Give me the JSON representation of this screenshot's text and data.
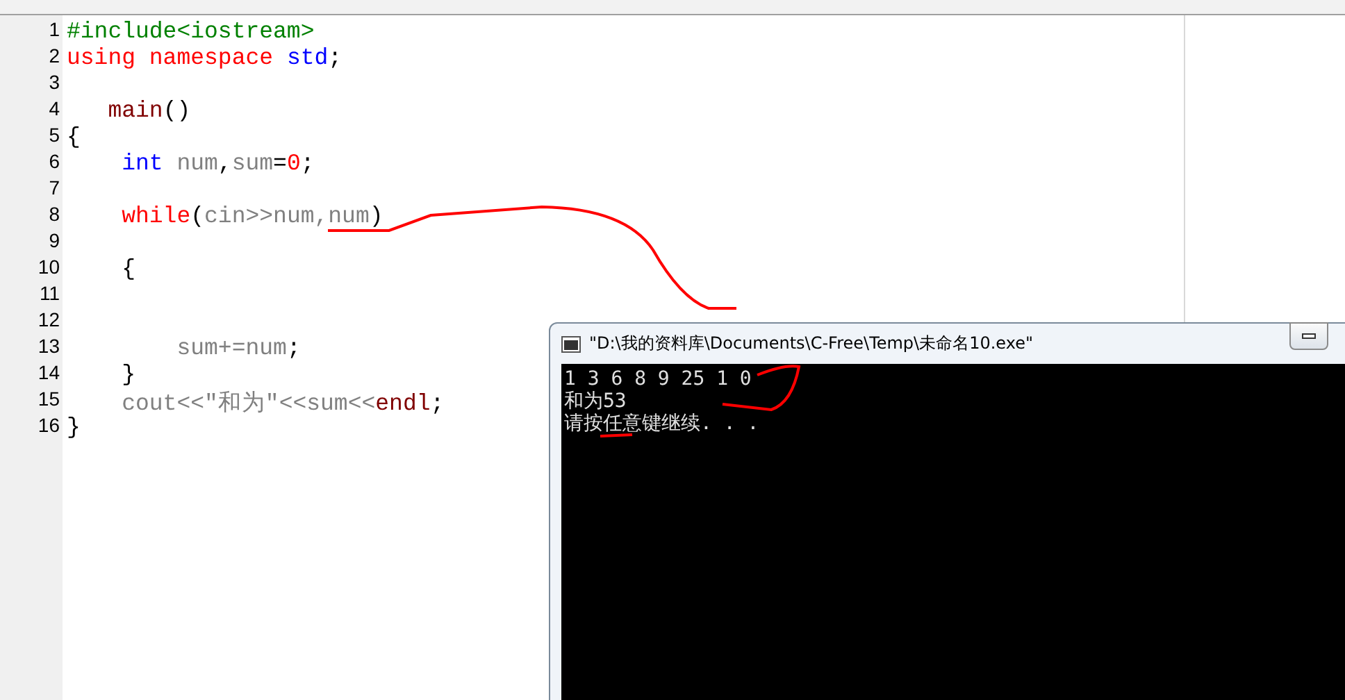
{
  "editor": {
    "lines": [
      {
        "number": "1",
        "tokens": [
          {
            "kind": "preprocessor",
            "text": "#include<iostream>"
          }
        ]
      },
      {
        "number": "2",
        "tokens": [
          {
            "kind": "keyword",
            "text": "using namespace "
          },
          {
            "kind": "type",
            "text": "std"
          },
          {
            "kind": "punct",
            "text": ";"
          }
        ]
      },
      {
        "number": "3"
      },
      {
        "number": "4",
        "tokens": [
          {
            "kind": "function",
            "text": "   main"
          },
          {
            "kind": "punct",
            "text": "()"
          }
        ]
      },
      {
        "number": "5",
        "tokens": [
          {
            "kind": "punct",
            "text": "{"
          }
        ]
      },
      {
        "number": "6",
        "tokens": [
          {
            "kind": "type",
            "text": "    int"
          },
          {
            "kind": "ident",
            "text": " num"
          },
          {
            "kind": "punct",
            "text": ","
          },
          {
            "kind": "ident",
            "text": "sum"
          },
          {
            "kind": "punct",
            "text": "="
          },
          {
            "kind": "number",
            "text": "0"
          },
          {
            "kind": "punct",
            "text": ";"
          }
        ]
      },
      {
        "number": "7"
      },
      {
        "number": "8",
        "tokens": [
          {
            "kind": "keyword",
            "text": "    while"
          },
          {
            "kind": "punct",
            "text": "("
          },
          {
            "kind": "ident",
            "text": "cin>>num,num"
          },
          {
            "kind": "punct",
            "text": ")"
          }
        ]
      },
      {
        "number": "9"
      },
      {
        "number": "10",
        "tokens": [
          {
            "kind": "punct",
            "text": "    {"
          }
        ]
      },
      {
        "number": "11"
      },
      {
        "number": "12"
      },
      {
        "number": "13",
        "tokens": [
          {
            "kind": "ident",
            "text": "        sum+=num"
          },
          {
            "kind": "punct",
            "text": ";"
          }
        ]
      },
      {
        "number": "14",
        "tokens": [
          {
            "kind": "punct",
            "text": "    }"
          }
        ]
      },
      {
        "number": "15",
        "tokens": [
          {
            "kind": "ident",
            "text": "    cout<<\"和为\"<<sum<<"
          },
          {
            "kind": "function",
            "text": "endl"
          },
          {
            "kind": "punct",
            "text": ";"
          }
        ]
      },
      {
        "number": "16",
        "tokens": [
          {
            "kind": "punct",
            "text": "}"
          }
        ]
      }
    ]
  },
  "console": {
    "title": "\"D:\\我的资料库\\Documents\\C-Free\\Temp\\未命名10.exe\"",
    "output": [
      "1 3 6 8 9 25 1 0",
      "和为53",
      "请按任意键继续. . ."
    ]
  }
}
